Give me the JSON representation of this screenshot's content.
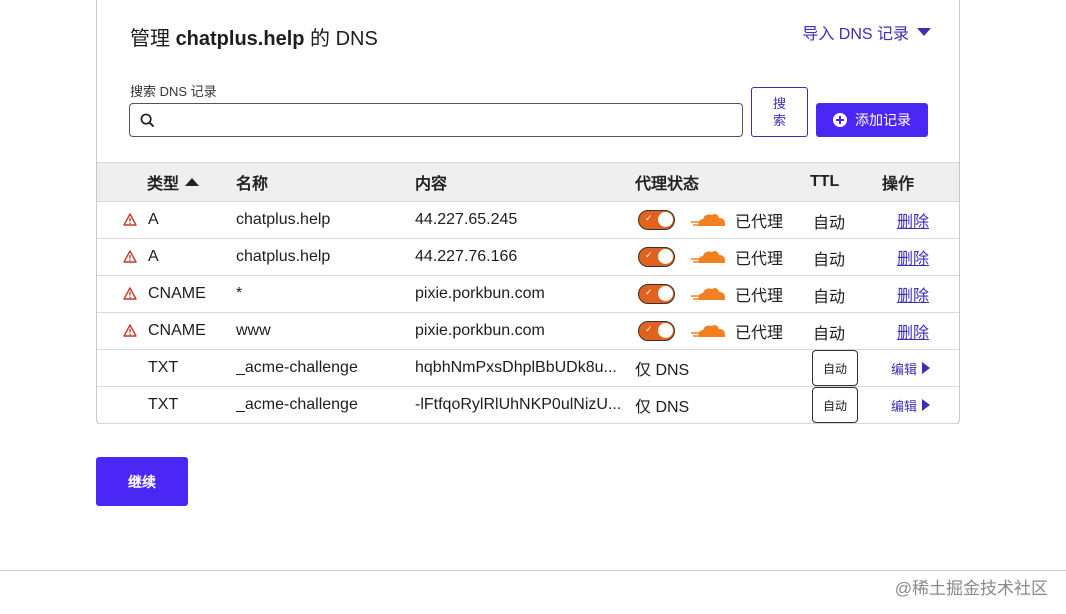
{
  "title": {
    "prefix": "管理",
    "domain": "chatplus.help",
    "suffix": "的 DNS"
  },
  "import_label": "导入 DNS 记录",
  "search": {
    "label": "搜索 DNS 记录",
    "value": "",
    "button_line1": "搜",
    "button_line2": "索"
  },
  "add_record_label": "添加记录",
  "table": {
    "headers": {
      "type": "类型",
      "name": "名称",
      "content": "内容",
      "proxy": "代理状态",
      "ttl": "TTL",
      "actions": "操作"
    },
    "rows": [
      {
        "type": "A",
        "name": "chatplus.help",
        "content": "44.227.65.245",
        "proxy": "已代理",
        "ttl": "自动",
        "action": "删除",
        "warning": true,
        "proxied": true
      },
      {
        "type": "A",
        "name": "chatplus.help",
        "content": "44.227.76.166",
        "proxy": "已代理",
        "ttl": "自动",
        "action": "删除",
        "warning": true,
        "proxied": true
      },
      {
        "type": "CNAME",
        "name": "*",
        "content": "pixie.porkbun.com",
        "proxy": "已代理",
        "ttl": "自动",
        "action": "删除",
        "warning": true,
        "proxied": true
      },
      {
        "type": "CNAME",
        "name": "www",
        "content": "pixie.porkbun.com",
        "proxy": "已代理",
        "ttl": "自动",
        "action": "删除",
        "warning": true,
        "proxied": true
      },
      {
        "type": "TXT",
        "name": "_acme-challenge",
        "content": "hqbhNmPxsDhplBbUDk8u...",
        "proxy": "仅 DNS",
        "ttl": "自动",
        "action": "编辑",
        "warning": false,
        "proxied": false
      },
      {
        "type": "TXT",
        "name": "_acme-challenge",
        "content": "-lFtfqoRylRlUhNKP0ulNizU...",
        "proxy": "仅 DNS",
        "ttl": "自动",
        "action": "编辑",
        "warning": false,
        "proxied": false
      }
    ]
  },
  "continue_label": "继续",
  "watermark": "@稀土掘金技术社区",
  "colors": {
    "accent": "#4a27f5",
    "link": "#3d2fb5",
    "toggle_on": "#e0621d",
    "cloud": "#f38020",
    "warning": "#c0392b"
  }
}
